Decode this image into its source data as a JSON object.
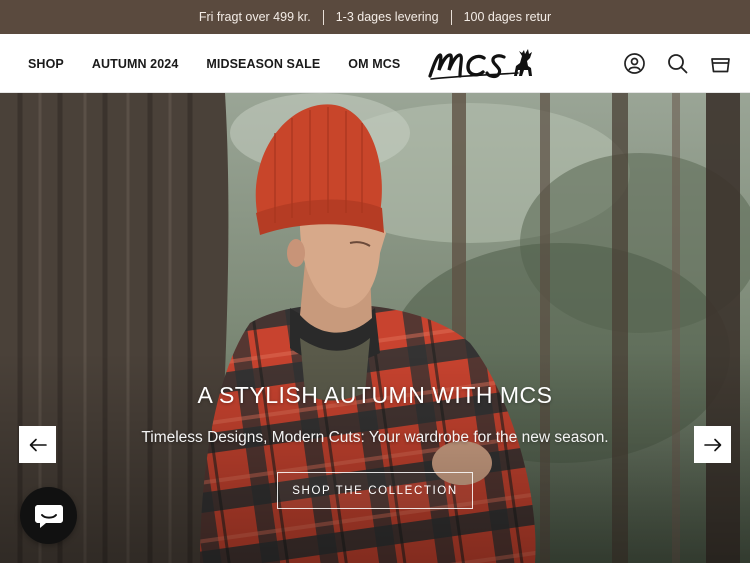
{
  "announcement": {
    "items": [
      "Fri fragt over 499 kr.",
      "1-3 dages levering",
      "100 dages retur"
    ]
  },
  "header": {
    "nav": [
      "SHOP",
      "AUTUMN 2024",
      "MIDSEASON SALE",
      "OM MCS"
    ],
    "logo_text": "mcs",
    "icons": [
      "account-icon",
      "search-icon",
      "cart-icon"
    ]
  },
  "hero": {
    "title": "A STYLISH AUTUMN WITH MCS",
    "subtitle": "Timeless Designs, Modern Cuts: Your wardrobe for the new season.",
    "cta": "SHOP THE COLLECTION",
    "prev_icon": "arrow-left-icon",
    "next_icon": "arrow-right-icon"
  },
  "chat": {
    "icon": "chat-bubble-icon"
  },
  "colors": {
    "announcement_bg": "#5a4a3e",
    "beanie": "#c8452a",
    "jacket_red": "#c8432f",
    "jacket_dark": "#2e3332"
  }
}
